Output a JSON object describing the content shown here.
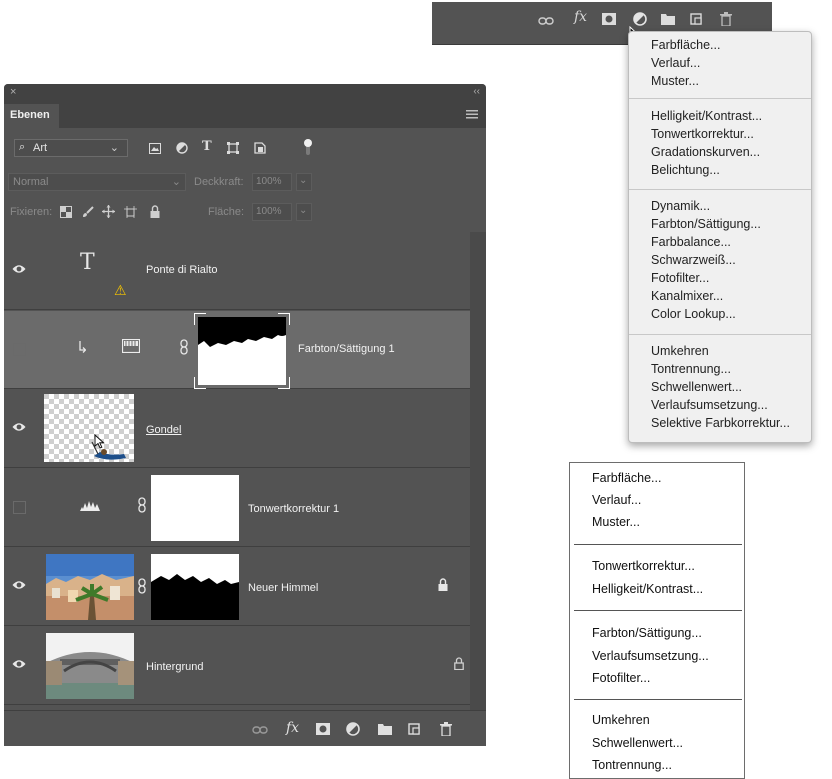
{
  "menu_adjustments": {
    "groups": [
      [
        "Farbfläche...",
        "Verlauf...",
        "Muster..."
      ],
      [
        "Helligkeit/Kontrast...",
        "Tonwertkorrektur...",
        "Gradationskurven...",
        "Belichtung..."
      ],
      [
        "Dynamik...",
        "Farbton/Sättigung...",
        "Farbbalance...",
        "Schwarzweiß...",
        "Fotofilter...",
        "Kanalmixer...",
        "Color Lookup..."
      ],
      [
        "Umkehren",
        "Tontrennung...",
        "Schwellenwert...",
        "Verlaufsumsetzung...",
        "Selektive Farbkorrektur..."
      ]
    ]
  },
  "menu_simple": {
    "groups": [
      [
        "Farbfläche...",
        "Verlauf...",
        "Muster..."
      ],
      [
        "Tonwertkorrektur...",
        "Helligkeit/Kontrast..."
      ],
      [
        "Farbton/Sättigung...",
        "Verlaufsumsetzung...",
        "Fotofilter..."
      ],
      [
        "Umkehren",
        "Schwellenwert...",
        "Tontrennung..."
      ]
    ]
  },
  "panel": {
    "tab": "Ebenen",
    "filter": "Art",
    "blend_mode": "Normal",
    "opacity_label": "Deckkraft:",
    "opacity_value": "100%",
    "lock_label": "Fixieren:",
    "fill_label": "Fläche:",
    "fill_value": "100%",
    "layers": [
      {
        "name": "Ponte di Rialto"
      },
      {
        "name": "Farbton/Sättigung 1"
      },
      {
        "name": "Gondel"
      },
      {
        "name": "Tonwertkorrektur 1"
      },
      {
        "name": "Neuer Himmel"
      },
      {
        "name": "Hintergrund"
      }
    ]
  },
  "icons": {
    "text_layer_glyph": "T",
    "fx": "fx",
    "warning": "⚠"
  },
  "colors": {
    "panel_bg": "#535353",
    "selected_row": "#6b6b6b",
    "warning": "#f5c400"
  }
}
